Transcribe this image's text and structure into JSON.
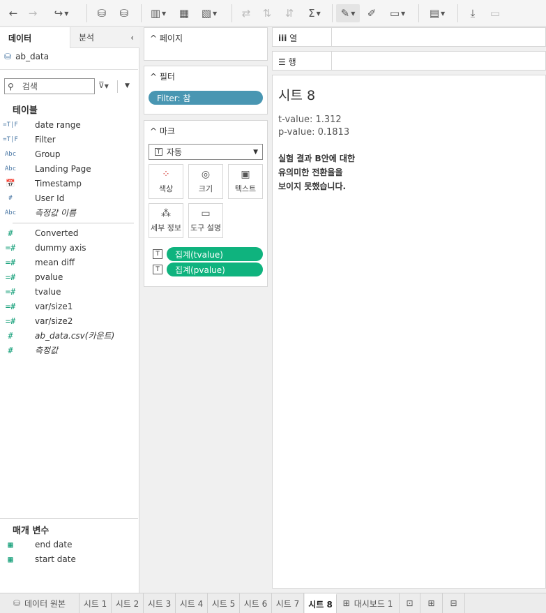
{
  "toolbar": {
    "undo_icon": "undo-icon",
    "redo_icon": "redo-icon"
  },
  "data_pane": {
    "tab_data": "데이터",
    "tab_analysis": "분석",
    "datasource": "ab_data",
    "search_placeholder": "검색",
    "tables_title": "테이블",
    "dimensions": [
      {
        "icon": "=T|F",
        "label": "date range",
        "italic": false
      },
      {
        "icon": "=T|F",
        "label": "Filter",
        "italic": false
      },
      {
        "icon": "Abc",
        "label": "Group",
        "italic": false
      },
      {
        "icon": "Abc",
        "label": "Landing Page",
        "italic": false
      },
      {
        "icon": "cal",
        "label": "Timestamp",
        "italic": false
      },
      {
        "icon": "#",
        "label": "User Id",
        "italic": false
      },
      {
        "icon": "Abc",
        "label": "측정값 이름",
        "italic": true
      }
    ],
    "measures": [
      {
        "icon": "#",
        "label": "Converted",
        "italic": false
      },
      {
        "icon": "=#",
        "label": "dummy axis",
        "italic": false
      },
      {
        "icon": "=#",
        "label": "mean diff",
        "italic": false
      },
      {
        "icon": "=#",
        "label": "pvalue",
        "italic": false
      },
      {
        "icon": "=#",
        "label": "tvalue",
        "italic": false
      },
      {
        "icon": "=#",
        "label": "var/size1",
        "italic": false
      },
      {
        "icon": "=#",
        "label": "var/size2",
        "italic": false
      },
      {
        "icon": "#",
        "label": "ab_data.csv(카운트)",
        "italic": true
      },
      {
        "icon": "#",
        "label": "측정값",
        "italic": true
      }
    ],
    "params_title": "매개 변수",
    "params": [
      {
        "label": "end date"
      },
      {
        "label": "start date"
      }
    ]
  },
  "cards": {
    "pages_title": "페이지",
    "filters_title": "필터",
    "filter_pill": "Filter: 참",
    "marks_title": "마크",
    "mark_type": "자동",
    "mark_buttons": {
      "color": "색상",
      "size": "크기",
      "text": "텍스트",
      "detail": "세부 정보",
      "tooltip": "도구 설명"
    },
    "mark_pills": [
      "집계(tvalue)",
      "집계(pvalue)"
    ]
  },
  "shelves": {
    "columns": "열",
    "rows": "행"
  },
  "sheet": {
    "title": "시트 8",
    "line1": "t-value: 1.312",
    "line2": "p-value: 0.1813",
    "note1": "실험 결과 B안에 대한",
    "note2": "유의미한 전환율을",
    "note3": "보이지 못했습니다."
  },
  "tabs": {
    "datasource": "데이터 원본",
    "sheets": [
      "시트 1",
      "시트 2",
      "시트 3",
      "시트 4",
      "시트 5",
      "시트 6",
      "시트 7",
      "시트 8"
    ],
    "dashboard": "대시보드 1"
  }
}
